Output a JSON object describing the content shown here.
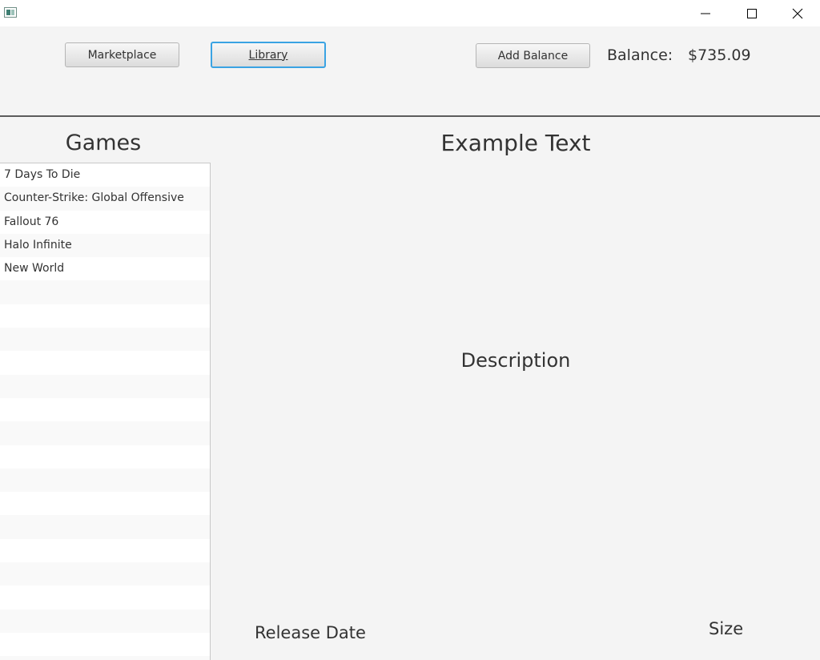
{
  "window": {
    "icon": "app-icon",
    "controls": {
      "minimize_icon": "minimize-icon",
      "maximize_icon": "maximize-icon",
      "close_icon": "close-icon"
    }
  },
  "toolbar": {
    "marketplace_label": "Marketplace",
    "library_label": "Library",
    "add_balance_label": "Add Balance",
    "balance_label": "Balance:",
    "balance_value": "$735.09"
  },
  "games_panel": {
    "title": "Games",
    "items": [
      "7 Days To Die",
      "Counter-Strike: Global Offensive",
      "Fallout 76",
      "Halo Infinite",
      "New World"
    ]
  },
  "detail": {
    "title": "Example Text",
    "description": "Description",
    "release_date": "Release Date",
    "size": "Size"
  },
  "colors": {
    "focus_accent": "#3aa3e3",
    "background": "#f4f4f4",
    "text": "#333333"
  }
}
